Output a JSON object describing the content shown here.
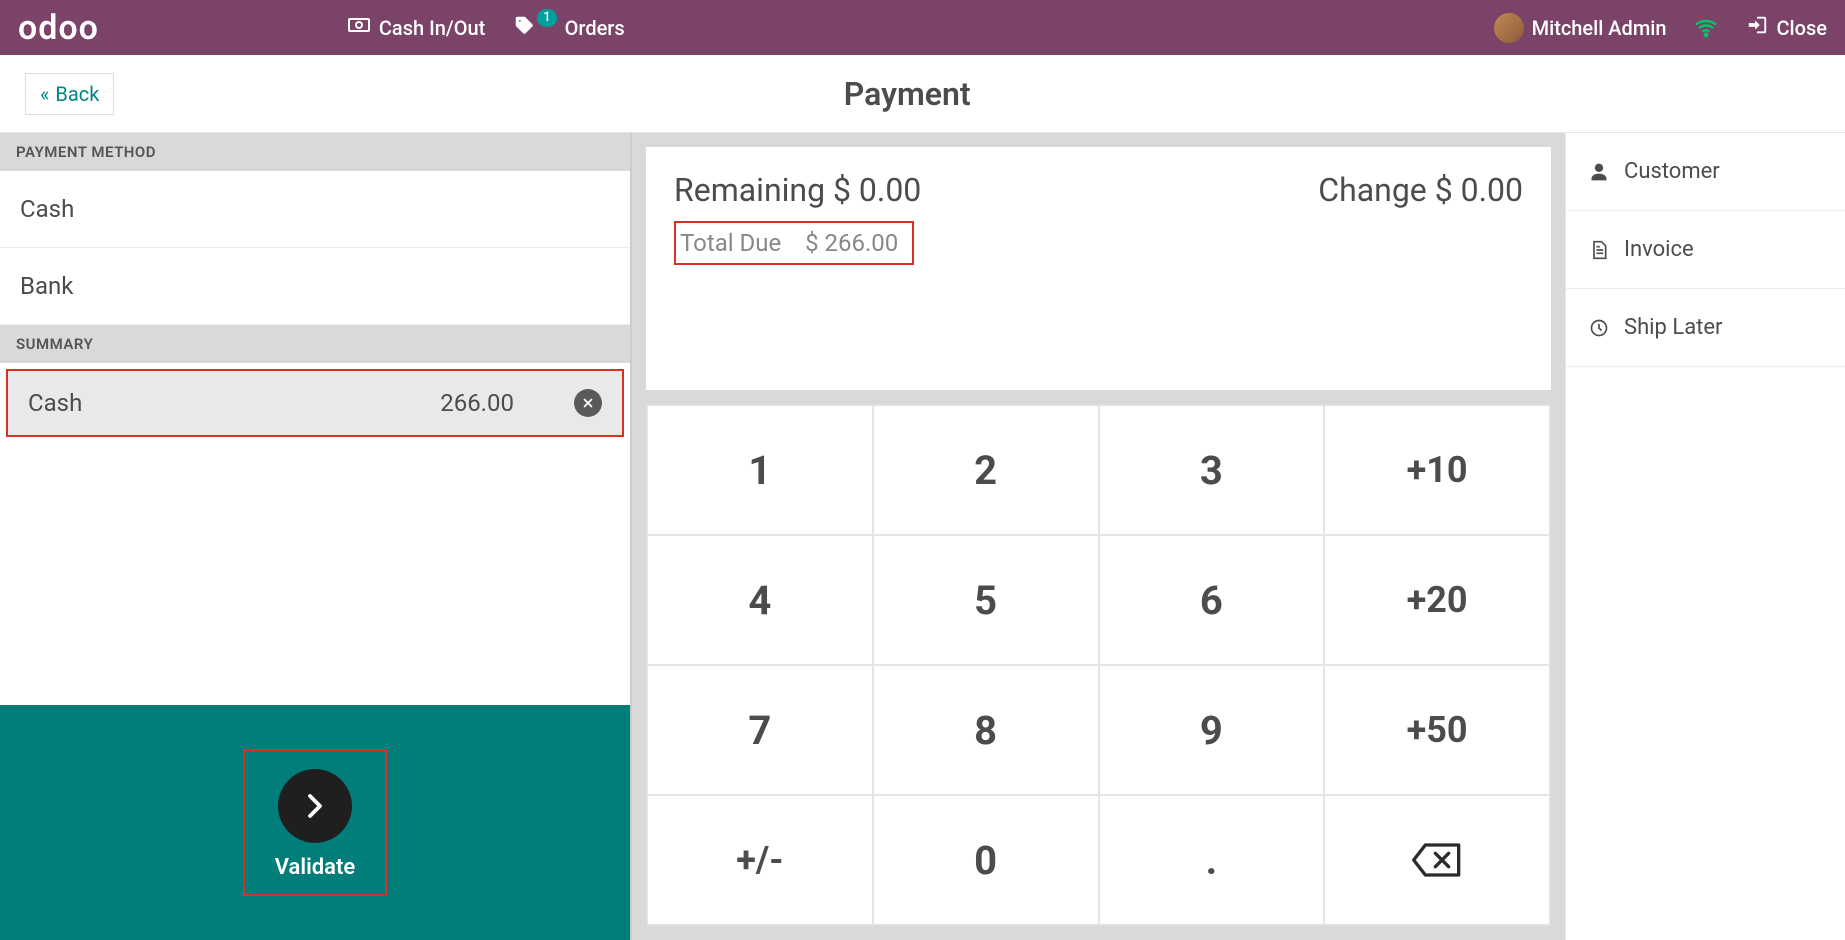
{
  "brand": "odoo",
  "topbar": {
    "cash": "Cash In/Out",
    "orders": "Orders",
    "orders_badge": "1",
    "user": "Mitchell Admin",
    "close": "Close"
  },
  "back_label": "Back",
  "page_title": "Payment",
  "left": {
    "payment_method_header": "PAYMENT METHOD",
    "methods": {
      "cash": "Cash",
      "bank": "Bank"
    },
    "summary_header": "SUMMARY",
    "summary": {
      "name": "Cash",
      "amount": "266.00"
    },
    "validate": "Validate"
  },
  "status": {
    "remaining_label": "Remaining",
    "remaining_value": "$ 0.00",
    "change_label": "Change",
    "change_value": "$ 0.00",
    "total_due_label": "Total Due",
    "total_due_value": "$ 266.00"
  },
  "keypad": {
    "k1": "1",
    "k2": "2",
    "k3": "3",
    "p10": "+10",
    "k4": "4",
    "k5": "5",
    "k6": "6",
    "p20": "+20",
    "k7": "7",
    "k8": "8",
    "k9": "9",
    "p50": "+50",
    "sign": "+/-",
    "k0": "0",
    "dot": "."
  },
  "right": {
    "customer": "Customer",
    "invoice": "Invoice",
    "ship": "Ship Later"
  }
}
